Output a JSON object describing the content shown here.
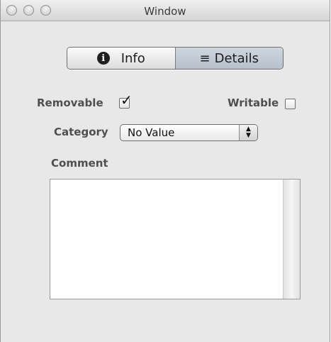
{
  "window": {
    "title": "Window",
    "buttons": [
      "close",
      "minimize",
      "zoom"
    ]
  },
  "segmented": {
    "info_label": "Info",
    "details_label": "Details",
    "info_icon": "info-circle-icon",
    "details_icon": "list-icon",
    "selected": "Details"
  },
  "form": {
    "removable_label": "Removable",
    "removable_checked": true,
    "writable_label": "Writable",
    "writable_checked": false,
    "category_label": "Category",
    "category_value": "No Value",
    "comment_label": "Comment",
    "comment_value": ""
  }
}
